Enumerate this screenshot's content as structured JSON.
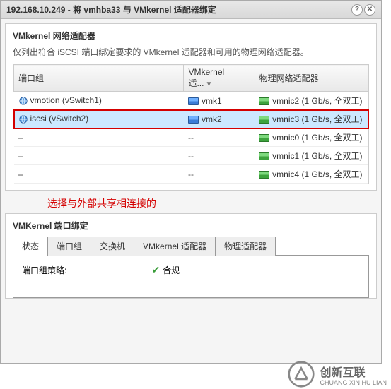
{
  "title": "192.168.10.249 - 将 vmhba33 与 VMkernel 适配器绑定",
  "section1": {
    "title": "VMkernel 网络适配器",
    "desc": "仅列出符合 iSCSI 端口绑定要求的 VMkernel 适配器和可用的物理网络适配器。",
    "headers": {
      "portgroup": "端口组",
      "vmk": "VMkernel 适...",
      "phys": "物理网络适配器"
    },
    "rows": [
      {
        "pg": "vmotion (vSwitch1)",
        "vmk": "vmk1",
        "phys": "vmnic2 (1 Gb/s, 全双工)",
        "hasPg": true,
        "selected": false
      },
      {
        "pg": "iscsi (vSwitch2)",
        "vmk": "vmk2",
        "phys": "vmnic3 (1 Gb/s, 全双工)",
        "hasPg": true,
        "selected": true
      },
      {
        "pg": "--",
        "vmk": "--",
        "phys": "vmnic0 (1 Gb/s, 全双工)",
        "hasPg": false,
        "selected": false
      },
      {
        "pg": "--",
        "vmk": "--",
        "phys": "vmnic1 (1 Gb/s, 全双工)",
        "hasPg": false,
        "selected": false
      },
      {
        "pg": "--",
        "vmk": "--",
        "phys": "vmnic4 (1 Gb/s, 全双工)",
        "hasPg": false,
        "selected": false
      }
    ]
  },
  "annotation": "选择与外部共享相连接的",
  "section2": {
    "title": "VMKernel 端口绑定",
    "tabs": [
      "状态",
      "端口组",
      "交换机",
      "VMkernel 适配器",
      "物理适配器"
    ],
    "policy_label": "端口组策略:",
    "policy_value": "合规"
  },
  "branding": {
    "name": "创新互联",
    "sub": "CHUANG XIN HU LIAN"
  }
}
